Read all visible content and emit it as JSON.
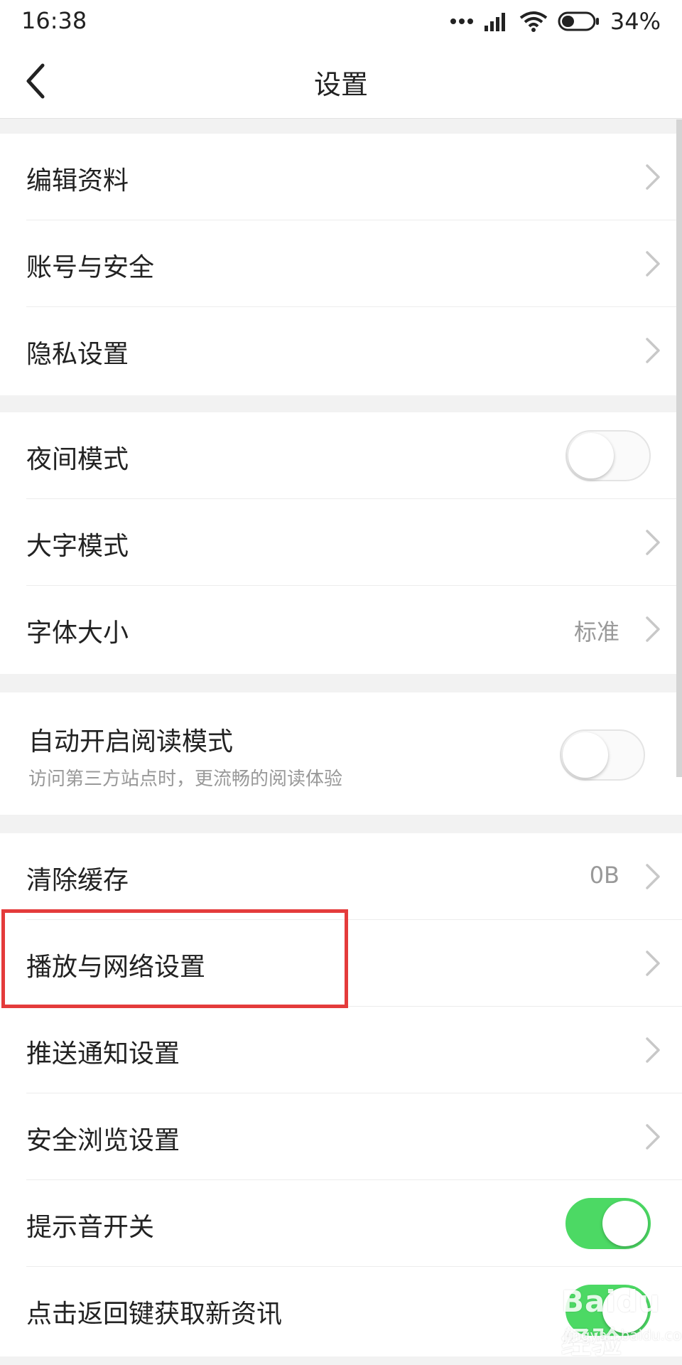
{
  "status_bar": {
    "time": "16:38",
    "battery_pct": "34%",
    "icons": [
      "more-dots-icon",
      "signal-icon",
      "wifi-icon",
      "battery-icon"
    ]
  },
  "header": {
    "title": "设置",
    "back_icon": "chevron-left-icon"
  },
  "groups": [
    {
      "items": [
        {
          "label": "编辑资料",
          "control": "chevron"
        },
        {
          "label": "账号与安全",
          "control": "chevron"
        },
        {
          "label": "隐私设置",
          "control": "chevron"
        }
      ]
    },
    {
      "items": [
        {
          "label": "夜间模式",
          "control": "toggle",
          "on": false
        },
        {
          "label": "大字模式",
          "control": "chevron"
        },
        {
          "label": "字体大小",
          "control": "chevron",
          "value": "标准"
        }
      ]
    },
    {
      "items": [
        {
          "label": "自动开启阅读模式",
          "subtitle": "访问第三方站点时，更流畅的阅读体验",
          "control": "toggle",
          "on": false
        }
      ]
    },
    {
      "items": [
        {
          "label": "清除缓存",
          "control": "chevron",
          "value": "0B"
        },
        {
          "label": "播放与网络设置",
          "control": "chevron",
          "highlighted": true
        },
        {
          "label": "推送通知设置",
          "control": "chevron"
        },
        {
          "label": "安全浏览设置",
          "control": "chevron"
        },
        {
          "label": "提示音开关",
          "control": "toggle",
          "on": true
        },
        {
          "label": "点击返回键获取新资讯",
          "control": "toggle",
          "on": true
        }
      ]
    }
  ],
  "colors": {
    "toggle_on": "#4cd964",
    "highlight_border": "#e43b3b",
    "page_bg": "#f2f2f2"
  },
  "watermark": {
    "logo": "Baidu经验",
    "sub": "jingyan.baidu.com"
  }
}
